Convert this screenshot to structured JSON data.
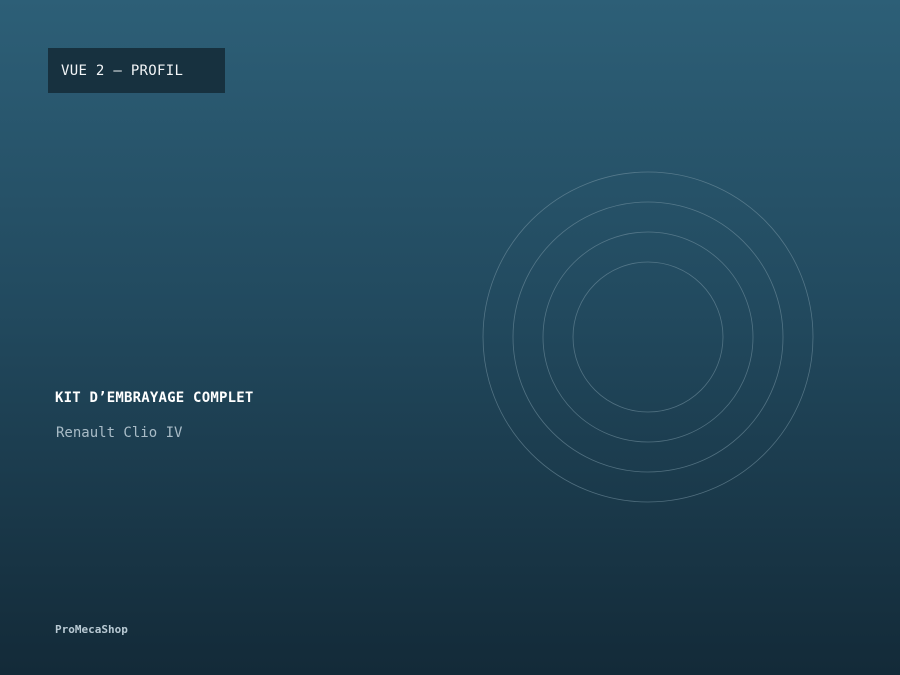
{
  "view_badge": {
    "label": "VUE 2 — PROFIL"
  },
  "product": {
    "title": "KIT D’EMBRAYAGE COMPLET",
    "subtitle": "Renault Clio IV"
  },
  "brand": {
    "name": "ProMecaShop"
  },
  "decoration": {
    "icon": "concentric-rings-icon",
    "stroke_color": "#7b99a8"
  }
}
